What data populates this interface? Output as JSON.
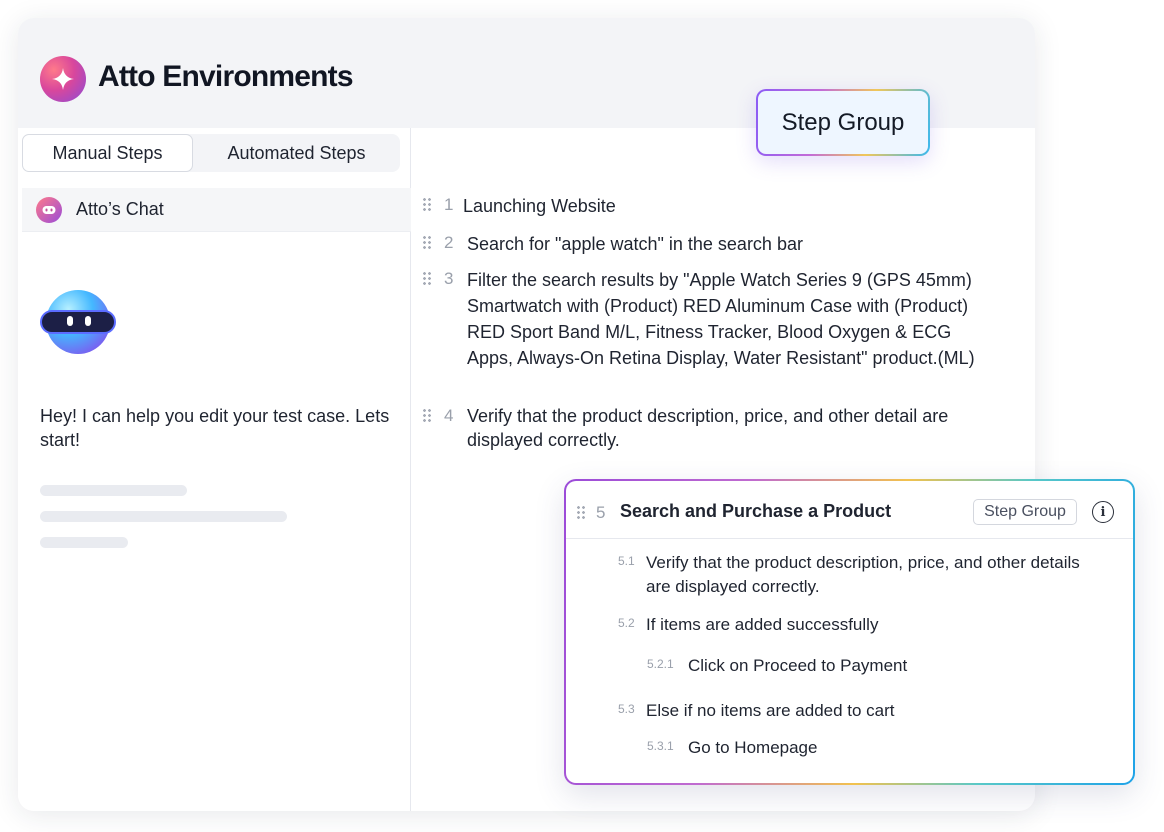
{
  "app": {
    "title": "Atto Environments",
    "logo_icon": "sparkle-icon"
  },
  "tabs": [
    {
      "label": "Manual Steps",
      "active": true
    },
    {
      "label": "Automated Steps",
      "active": false
    }
  ],
  "chat": {
    "title": "Atto’s Chat",
    "greeting": "Hey! I can help you edit your test case. Lets start!"
  },
  "step_group_chip": "Step Group",
  "steps": [
    {
      "number": "1",
      "text": "Launching Website"
    },
    {
      "number": "2",
      "text": "Search for \"apple watch\" in the search bar"
    },
    {
      "number": "3",
      "text": "Filter the search results by \"Apple Watch Series 9 (GPS 45mm) Smartwatch with (Product) RED Aluminum Case with (Product) RED Sport Band M/L, Fitness Tracker, Blood Oxygen & ECG Apps, Always-On Retina Display, Water Resistant\" product.(ML)"
    },
    {
      "number": "4",
      "text": "Verify that the product description, price, and other detail are displayed correctly."
    }
  ],
  "group": {
    "number": "5",
    "title": "Search and Purchase a Product",
    "badge": "Step Group",
    "substeps": [
      {
        "number": "5.1",
        "text": "Verify that the product description, price, and other details are displayed correctly."
      },
      {
        "number": "5.2",
        "text": "If items are added successfully"
      },
      {
        "number": "5.2.1",
        "text": "Click on Proceed to Payment"
      },
      {
        "number": "5.3",
        "text": "Else if no items are added to cart"
      },
      {
        "number": "5.3.1",
        "text": "Go to Homepage"
      }
    ]
  },
  "colors": {
    "accent_purple": "#8b5cf6",
    "accent_blue": "#1ea2e8",
    "accent_yellow": "#f2c24e",
    "header_bg": "#f3f4f7"
  }
}
